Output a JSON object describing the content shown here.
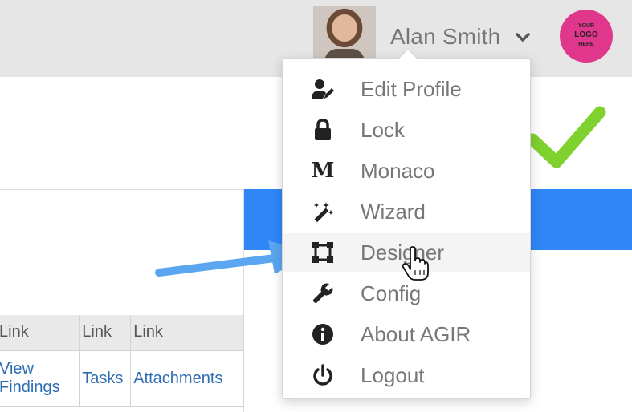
{
  "header": {
    "user_name": "Alan Smith",
    "logo_text": [
      "YOUR",
      "LOGO",
      "HERE"
    ],
    "logo_color": "#e0368c",
    "header_bg": "#e6e6e6"
  },
  "menu": {
    "items": [
      {
        "label": "Edit Profile",
        "icon": "user-edit-icon"
      },
      {
        "label": "Lock",
        "icon": "lock-icon"
      },
      {
        "label": "Monaco",
        "icon": "monaco-m-icon",
        "glyph": "M"
      },
      {
        "label": "Wizard",
        "icon": "magic-wand-icon"
      },
      {
        "label": "Designer",
        "icon": "designer-icon",
        "hovered": true
      },
      {
        "label": "Config",
        "icon": "wrench-icon"
      },
      {
        "label": "About AGIR",
        "icon": "info-icon"
      },
      {
        "label": "Logout",
        "icon": "power-icon"
      }
    ]
  },
  "table": {
    "headers": [
      "Link",
      "Link",
      "Link"
    ],
    "row": [
      "View Findings",
      "Tasks",
      "Attachments"
    ],
    "row_lines": [
      [
        "View",
        "Findings"
      ],
      [
        "Tasks"
      ],
      [
        "Attachments"
      ]
    ]
  },
  "colors": {
    "accent_blue": "#2f86f6",
    "link_blue": "#2e6db3",
    "check_green": "#7fd12e",
    "arrow_blue": "#5aa6f0"
  }
}
